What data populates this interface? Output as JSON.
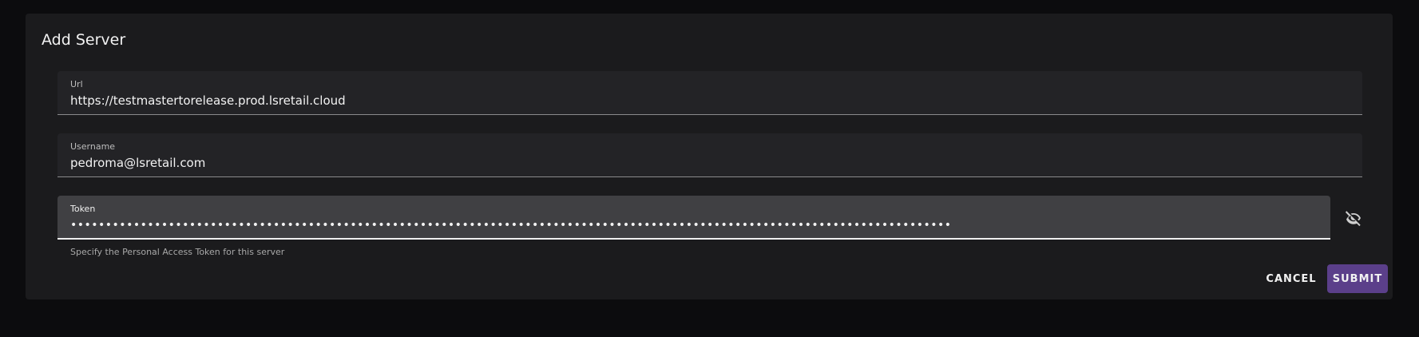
{
  "dialog": {
    "title": "Add Server",
    "fields": {
      "url": {
        "label": "Url",
        "value": "https://testmastertorelease.prod.lsretail.cloud"
      },
      "username": {
        "label": "Username",
        "value": "pedroma@lsretail.com"
      },
      "token": {
        "label": "Token",
        "value": "••••••••••••••••••••••••••••••••••••••••••••••••••••••••••••••••••••••••••••••••••••••••••••••••••••••••••••••••••••••••••••••",
        "helper": "Specify the Personal Access Token for this server",
        "visibility_icon": "eye-off-icon"
      }
    },
    "actions": {
      "cancel_label": "CANCEL",
      "submit_label": "SUBMIT"
    }
  },
  "colors": {
    "background": "#0c0c0e",
    "dialog": "#1b1b1d",
    "field": "#232326",
    "active_field": "#404043",
    "submit": "#5b3f8a"
  }
}
